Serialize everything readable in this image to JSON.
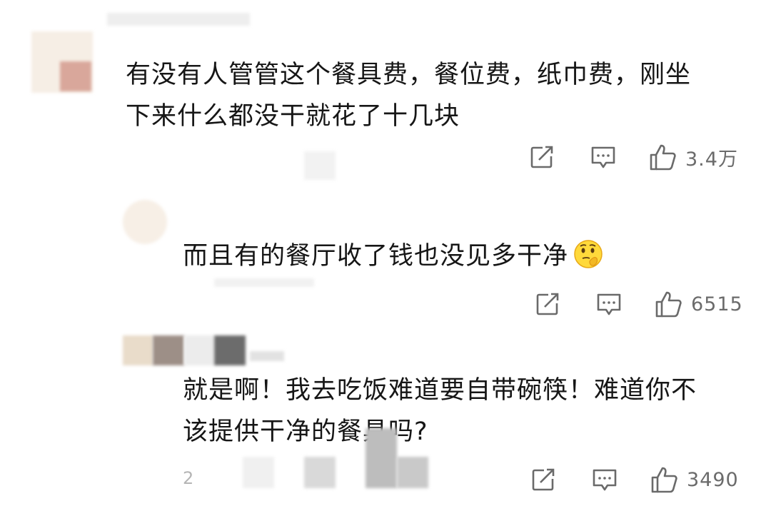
{
  "comments": [
    {
      "lines": [
        "有没有人管管这个餐具费，餐位费，纸巾费，刚坐",
        "下来什么都没干就花了十几块"
      ],
      "likes": "3.4万",
      "actions": {
        "share_icon": "share-icon",
        "reply_icon": "comment-icon",
        "like_icon": "thumbs-up-icon"
      }
    },
    {
      "lines": [
        "而且有的餐厅收了钱也没见多干净"
      ],
      "emoji": "thinking-emoji",
      "likes": "6515",
      "actions": {
        "share_icon": "share-icon",
        "reply_icon": "comment-icon",
        "like_icon": "thumbs-up-icon"
      }
    },
    {
      "lines": [
        "就是啊！我去吃饭难道要自带碗筷！难道你不",
        "该提供干净的餐具吗?"
      ],
      "meta": "2",
      "likes": "3490",
      "actions": {
        "share_icon": "share-icon",
        "reply_icon": "comment-icon",
        "like_icon": "thumbs-up-icon"
      }
    }
  ],
  "colors": {
    "text": "#161616",
    "meta": "#6b6b6b",
    "icon": "#555555",
    "background": "#ffffff"
  }
}
